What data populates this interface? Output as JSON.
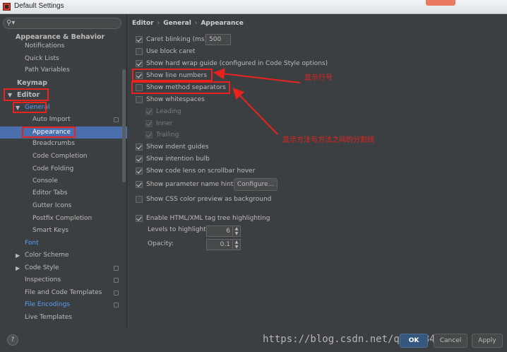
{
  "window": {
    "title": "Default Settings"
  },
  "search": {
    "placeholder": ""
  },
  "sidebar": {
    "items": [
      {
        "label": "Appearance & Behavior",
        "level": 0,
        "bold": true
      },
      {
        "label": "Notifications",
        "level": 1
      },
      {
        "label": "Quick Lists",
        "level": 1
      },
      {
        "label": "Path Variables",
        "level": 1
      },
      {
        "label": "Keymap",
        "level": 0,
        "bold": true
      },
      {
        "label": "Editor",
        "level": 0,
        "bold": true,
        "expanded": true
      },
      {
        "label": "General",
        "level": 1,
        "expanded": true,
        "color": "blue"
      },
      {
        "label": "Auto Import",
        "level": 2,
        "copy": true
      },
      {
        "label": "Appearance",
        "level": 2,
        "selected": true
      },
      {
        "label": "Breadcrumbs",
        "level": 2
      },
      {
        "label": "Code Completion",
        "level": 2
      },
      {
        "label": "Code Folding",
        "level": 2
      },
      {
        "label": "Console",
        "level": 2
      },
      {
        "label": "Editor Tabs",
        "level": 2
      },
      {
        "label": "Gutter Icons",
        "level": 2
      },
      {
        "label": "Postfix Completion",
        "level": 2
      },
      {
        "label": "Smart Keys",
        "level": 2
      },
      {
        "label": "Font",
        "level": 1,
        "color": "blue"
      },
      {
        "label": "Color Scheme",
        "level": 1,
        "collapsed": true
      },
      {
        "label": "Code Style",
        "level": 1,
        "collapsed": true,
        "copy": true
      },
      {
        "label": "Inspections",
        "level": 1,
        "copy": true
      },
      {
        "label": "File and Code Templates",
        "level": 1,
        "copy": true
      },
      {
        "label": "File Encodings",
        "level": 1,
        "color": "blue",
        "copy": true
      },
      {
        "label": "Live Templates",
        "level": 1
      }
    ]
  },
  "breadcrumb": [
    "Editor",
    "General",
    "Appearance"
  ],
  "options": {
    "caret_blinking": {
      "label": "Caret blinking (ms):",
      "checked": true,
      "value": "500"
    },
    "block_caret": {
      "label": "Use block caret",
      "checked": false
    },
    "hard_wrap": {
      "label": "Show hard wrap guide (configured in Code Style options)",
      "checked": true
    },
    "line_numbers": {
      "label": "Show line numbers",
      "checked": true
    },
    "method_separators": {
      "label": "Show method separators",
      "checked": false
    },
    "whitespaces": {
      "label": "Show whitespaces",
      "checked": false
    },
    "leading": {
      "label": "Leading",
      "checked": true,
      "disabled": true
    },
    "inner": {
      "label": "Inner",
      "checked": true,
      "disabled": true
    },
    "trailing": {
      "label": "Trailing",
      "checked": true,
      "disabled": true
    },
    "indent_guides": {
      "label": "Show indent guides",
      "checked": true
    },
    "intention_bulb": {
      "label": "Show intention bulb",
      "checked": true
    },
    "code_lens": {
      "label": "Show code lens on scrollbar hover",
      "checked": true
    },
    "param_hints": {
      "label": "Show parameter name hints",
      "checked": true,
      "button": "Configure..."
    },
    "css_preview": {
      "label": "Show CSS color preview as background",
      "checked": false
    },
    "tag_tree": {
      "label": "Enable HTML/XML tag tree highlighting",
      "checked": true
    },
    "levels": {
      "label": "Levels to highlight:",
      "value": "6"
    },
    "opacity": {
      "label": "Opacity:",
      "value": "0.1"
    }
  },
  "footer": {
    "help": "?",
    "ok": "OK",
    "cancel": "Cancel",
    "apply": "Apply"
  },
  "watermark": "https://blog.csdn.net/qq_31840023",
  "annotations": {
    "line_numbers_note": "显示行号",
    "separators_note": "显示方法与方法之间的分割线",
    "color": "#e8231e"
  },
  "colors": {
    "background": "#3c3f41",
    "selection": "#4b6eaf",
    "link_blue": "#589df6",
    "text": "#bbbbbb"
  }
}
